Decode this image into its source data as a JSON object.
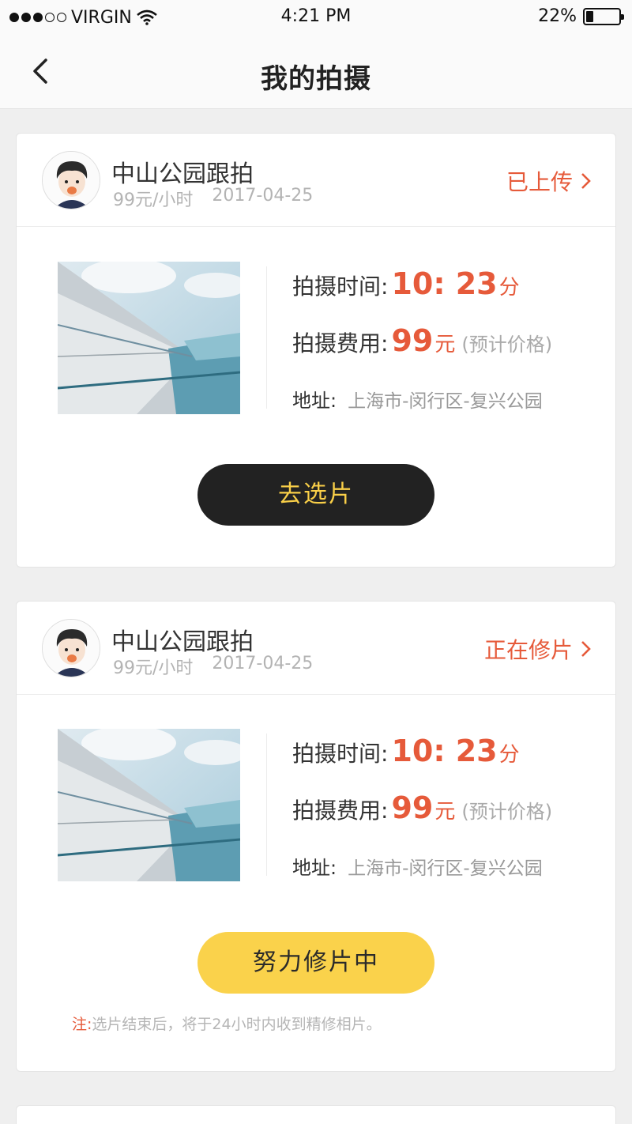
{
  "status_bar": {
    "carrier": "VIRGIN",
    "time": "4:21 PM",
    "battery_percent_label": "22%",
    "battery_fraction": 0.22,
    "signal_bars_filled": 3,
    "signal_bars_total": 5
  },
  "nav": {
    "title": "我的拍摄",
    "back_icon": "chevron-left-icon"
  },
  "colors": {
    "accent_red": "#e65a3a",
    "button_dark": "#222222",
    "button_yellow": "#fad24b",
    "button_dark_text": "#f9cf48"
  },
  "orders": [
    {
      "title": "中山公园跟拍",
      "rate": "99元/小时",
      "date": "2017-04-25",
      "status": "已上传",
      "time_label": "拍摄时间:",
      "time_value": "10: 23",
      "time_unit": "分",
      "fee_label": "拍摄费用:",
      "fee_value": "99",
      "fee_unit": "元",
      "fee_note": "(预计价格)",
      "address_label": "地址:",
      "address": "上海市-闵行区-复兴公园",
      "button_label": "去选片",
      "button_style": "dark"
    },
    {
      "title": "中山公园跟拍",
      "rate": "99元/小时",
      "date": "2017-04-25",
      "status": "正在修片",
      "time_label": "拍摄时间:",
      "time_value": "10: 23",
      "time_unit": "分",
      "fee_label": "拍摄费用:",
      "fee_value": "99",
      "fee_unit": "元",
      "fee_note": "(预计价格)",
      "address_label": "地址:",
      "address": "上海市-闵行区-复兴公园",
      "button_label": "努力修片中",
      "button_style": "yellow",
      "note_prefix": "注:",
      "note_text": "选片结束后，将于24小时内收到精修相片。"
    }
  ]
}
